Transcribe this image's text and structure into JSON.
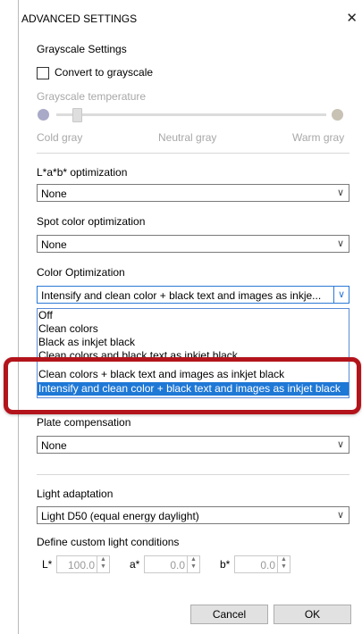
{
  "dialog": {
    "title": "ADVANCED SETTINGS",
    "close_icon": "close-icon"
  },
  "grayscale": {
    "section_title": "Grayscale Settings",
    "checkbox_label": "Convert to grayscale",
    "checkbox_checked": false,
    "temp_label": "Grayscale temperature",
    "slider_value": 0,
    "scale_labels": [
      "Cold gray",
      "Neutral gray",
      "Warm gray"
    ],
    "colors": {
      "cold": "#a9a9c8",
      "warm": "#c8c2b4"
    }
  },
  "lab": {
    "label": "L*a*b* optimization",
    "value": "None"
  },
  "spot": {
    "label": "Spot color optimization",
    "value": "None"
  },
  "color_opt": {
    "label": "Color Optimization",
    "value": "Intensify and clean color + black text and images as inkje...",
    "options": [
      "Off",
      "Clean colors",
      "Black as inkjet black",
      "Clean colors and black text as inkjet black",
      "Clean colors + black text and images as inkjet black",
      "Intensify and clean color + black text and images as inkjet black"
    ],
    "selected_index": 5
  },
  "plate": {
    "label": "Plate compensation",
    "value": "None"
  },
  "light": {
    "label": "Light adaptation",
    "value": "Light D50 (equal energy daylight)"
  },
  "custom_light": {
    "label": "Define custom light conditions",
    "L_label": "L*",
    "L_value": "100.0",
    "a_label": "a*",
    "a_value": "0.0",
    "b_label": "b*",
    "b_value": "0.0"
  },
  "buttons": {
    "cancel": "Cancel",
    "ok": "OK"
  },
  "accent_colors": {
    "selection": "#1e78d6",
    "highlight_box": "#b3141b"
  }
}
